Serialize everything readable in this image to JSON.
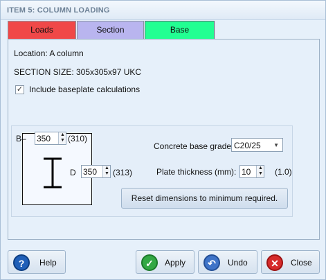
{
  "window": {
    "title": "ITEM 5: COLUMN LOADING"
  },
  "tabs": [
    {
      "label": "Loads",
      "color": "#f04848"
    },
    {
      "label": "Section",
      "color": "#b9b5ef"
    },
    {
      "label": "Base",
      "color": "#22ff92",
      "active": true
    }
  ],
  "info": {
    "location": "Location: A column",
    "section_size": "SECTION SIZE: 305x305x97 UKC"
  },
  "include_baseplate": {
    "label": "Include baseplate calculations",
    "checked": true
  },
  "dimensions": {
    "b_label": "B",
    "b_value": "350",
    "b_min": "(310)",
    "d_label": "D",
    "d_value": "350",
    "d_min": "(313)"
  },
  "concrete": {
    "label": "Concrete base grade",
    "value": "C20/25"
  },
  "plate": {
    "label": "Plate thickness (mm):",
    "value": "10",
    "min": "(1.0)"
  },
  "reset_button": "Reset dimensions to minimum required.",
  "buttons": {
    "help": "Help",
    "apply": "Apply",
    "undo": "Undo",
    "close": "Close"
  },
  "icons": {
    "help": "help-icon",
    "apply": "checkmark-icon",
    "undo": "undo-icon",
    "close": "close-icon"
  }
}
